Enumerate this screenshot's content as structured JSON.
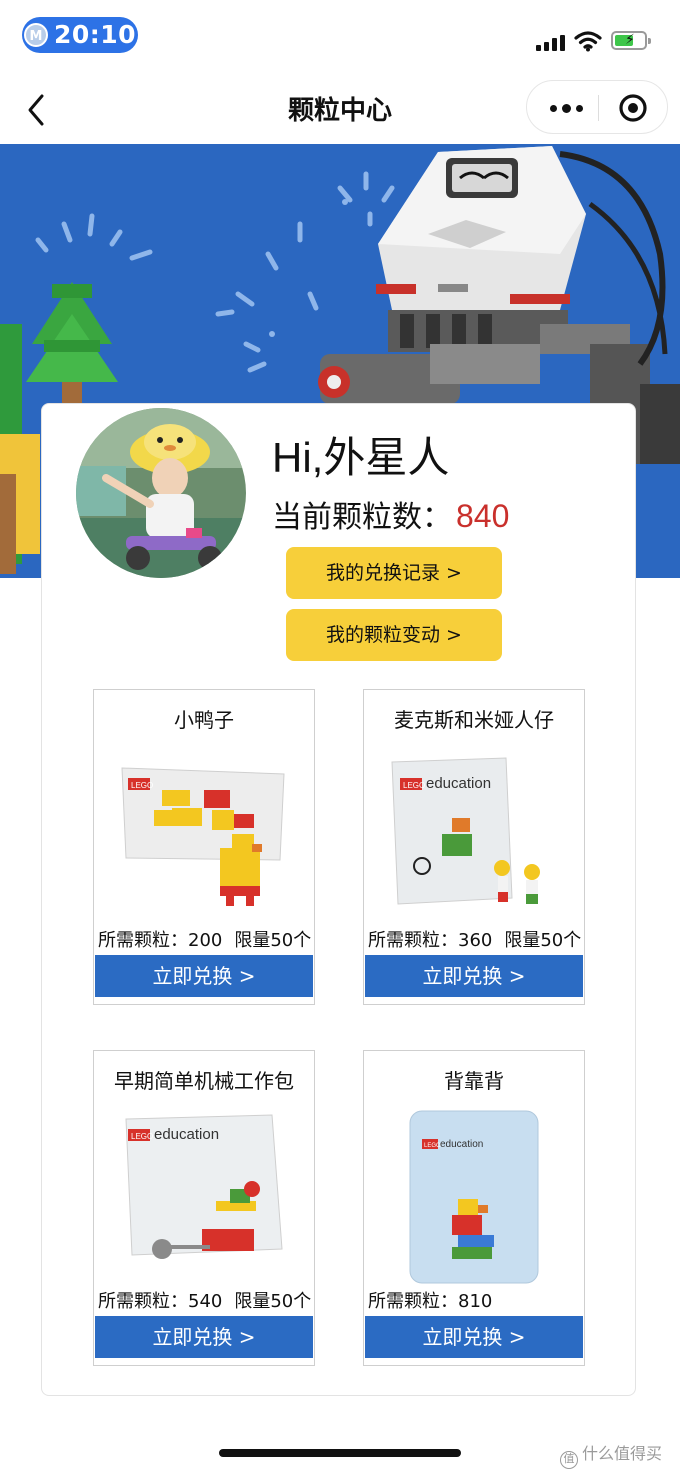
{
  "status_bar": {
    "badge": "M",
    "time": "20:10"
  },
  "nav": {
    "title": "颗粒中心"
  },
  "profile": {
    "greeting": "Hi,外星人",
    "points_label": "当前颗粒数：",
    "points_value": "840"
  },
  "actions": {
    "exchange_records": "我的兑换记录 >",
    "points_changes": "我的颗粒变动 >"
  },
  "products": [
    {
      "title": "小鸭子",
      "points_text": "所需颗粒：200",
      "limit_text": "限量50个",
      "button": "立即兑换 >"
    },
    {
      "title": "麦克斯和米娅人仔",
      "points_text": "所需颗粒：360",
      "limit_text": "限量50个",
      "button": "立即兑换 >"
    },
    {
      "title": "早期简单机械工作包",
      "points_text": "所需颗粒：540",
      "limit_text": "限量50个",
      "button": "立即兑换 >"
    },
    {
      "title": "背靠背",
      "points_text": "所需颗粒：810",
      "limit_text": "",
      "button": "立即兑换 >"
    }
  ],
  "watermark": {
    "text": "什么值得买"
  },
  "colors": {
    "banner_blue": "#2b67c0",
    "button_blue": "#2b6bc3",
    "button_yellow": "#f7cf3a",
    "points_red": "#c9302c"
  },
  "icons": [
    "back-chevron-icon",
    "more-dots-icon",
    "close-target-icon",
    "wifi-icon",
    "signal-icon",
    "battery-icon"
  ]
}
